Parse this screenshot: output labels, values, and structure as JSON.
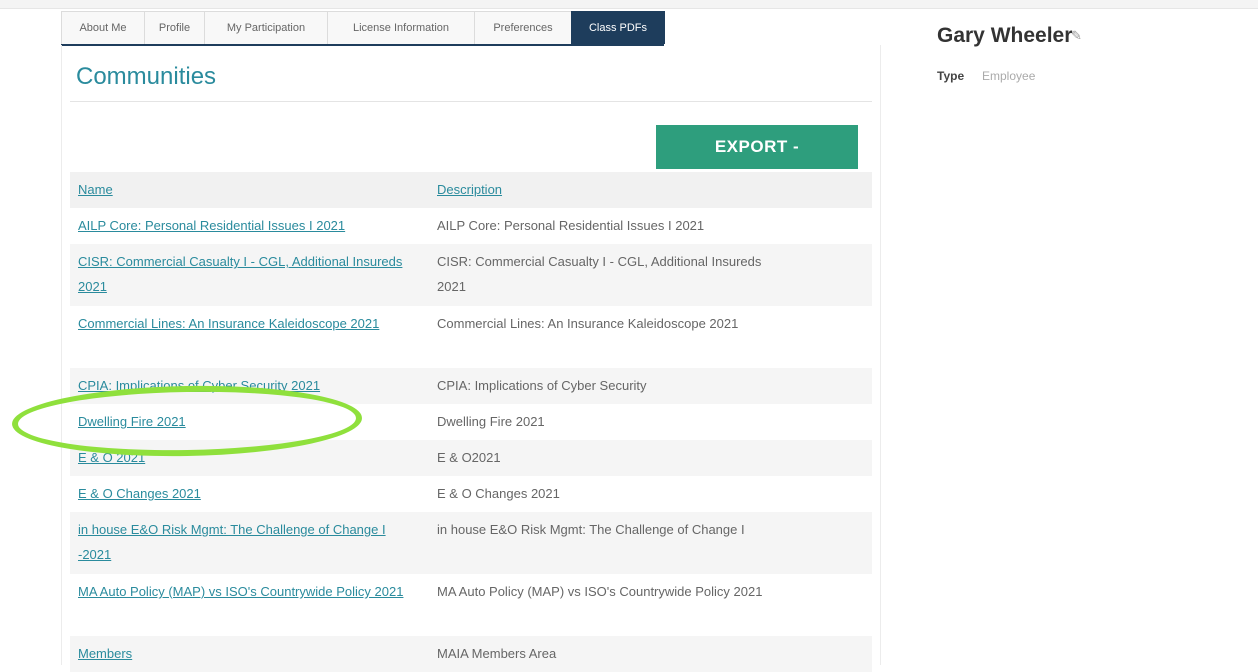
{
  "tabs": [
    {
      "label": "About Me"
    },
    {
      "label": "Profile"
    },
    {
      "label": "My Participation"
    },
    {
      "label": "License Information"
    },
    {
      "label": "Preferences"
    },
    {
      "label": "Class PDFs"
    }
  ],
  "heading": "Communities",
  "export_label": "EXPORT -",
  "table": {
    "headers": {
      "name": "Name",
      "description": "Description"
    },
    "rows": [
      {
        "name": "AILP Core: Personal Residential Issues I 2021",
        "description": "AILP Core: Personal Residential Issues I 2021"
      },
      {
        "name": "CISR: Commercial Casualty I - CGL, Additional Insureds 2021",
        "description": "CISR: Commercial Casualty I - CGL, Additional Insureds 2021"
      },
      {
        "name": "Commercial Lines: An Insurance Kaleidoscope 2021",
        "description": "Commercial Lines: An Insurance Kaleidoscope 2021"
      },
      {
        "name": "CPIA: Implications of Cyber Security 2021",
        "description": "CPIA: Implications of Cyber Security"
      },
      {
        "name": "Dwelling Fire 2021",
        "description": "Dwelling Fire 2021"
      },
      {
        "name": "E & O 2021",
        "description": "E & O2021"
      },
      {
        "name": "E & O Changes 2021",
        "description": "E & O Changes 2021"
      },
      {
        "name": "in house E&O Risk Mgmt: The Challenge of Change I -2021",
        "description": "in house E&O Risk Mgmt: The Challenge of Change I"
      },
      {
        "name": "MA Auto Policy (MAP) vs ISO's Countrywide Policy 2021",
        "description": "MA Auto Policy (MAP) vs ISO's Countrywide Policy 2021"
      },
      {
        "name": "Members",
        "description": "MAIA Members Area"
      }
    ]
  },
  "profile": {
    "name": "Gary Wheeler",
    "edit_icon": "pencil-icon",
    "type_label": "Type",
    "type_value": "Employee"
  },
  "colors": {
    "accent": "#2a8b9d",
    "active_tab": "#1e3d5c",
    "export_button": "#2e9e7d",
    "highlight": "#8fe03c"
  }
}
